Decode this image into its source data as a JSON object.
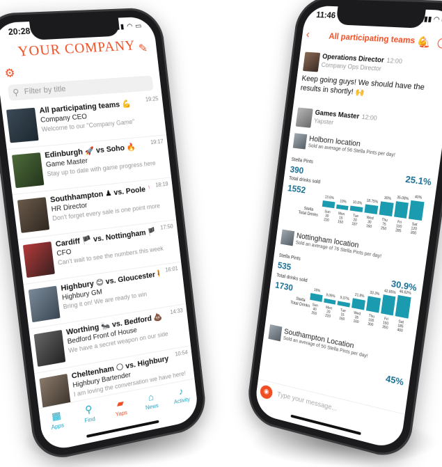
{
  "left_phone": {
    "status_time": "20:28",
    "brand": "YOUR COMPANY",
    "search_placeholder": "Filter by title",
    "rows": [
      {
        "title": "All participating teams 💪",
        "sub": "Company CEO",
        "msg": "Welcome to our \"Company Game\"",
        "time": "19:25"
      },
      {
        "title": "Edinburgh 🚀 vs Soho 🔥",
        "sub": "Game Master",
        "msg": "Stay up to date with game progress here",
        "time": "19:17"
      },
      {
        "title": "Southhampton ♟ vs. Poole 🥊",
        "sub": "HR Director",
        "msg": "Don't forget every sale is one point more",
        "time": "18:19"
      },
      {
        "title": "Cardiff 🏴 vs. Nottingham 🏴",
        "sub": "CFO",
        "msg": "Can't wait to see the numbers this week",
        "time": "17:50"
      },
      {
        "title": "Highbury 😊 vs. Gloucester 🐯",
        "sub": "Highbury GM",
        "msg": "Bring it on! We are ready to win",
        "time": "16:01"
      },
      {
        "title": "Worthing 🐜 vs. Bedford 💩",
        "sub": "Bedford Front of House",
        "msg": "We have a secret weapon on our side",
        "time": "14:33"
      },
      {
        "title": "Cheltenham 🌕 vs. Highbury 🌙",
        "sub": "Highbury Bartender",
        "msg": "I am loving the conversation we have here!",
        "time": "10:54"
      }
    ],
    "tabs": [
      {
        "label": "Apps",
        "icon": "grid-icon"
      },
      {
        "label": "Find",
        "icon": "search-icon"
      },
      {
        "label": "Yaps",
        "icon": "chat-icon"
      },
      {
        "label": "News",
        "icon": "home-icon"
      },
      {
        "label": "Activity",
        "icon": "bell-icon"
      }
    ]
  },
  "right_phone": {
    "status_time": "11:46",
    "chat_title": "All participating teams 💪",
    "messages": [
      {
        "name": "Operations Director",
        "time": "12:00",
        "role": "Company Ops Director",
        "text": "Keep going guys! We should have the results in shortly! 🙌"
      },
      {
        "name": "Games Master",
        "time": "12:00",
        "role": "Yapster",
        "text": ""
      }
    ],
    "cards": [
      {
        "title": "Holborn location",
        "desc": "Sold an average of 56 Stella Pints per day!",
        "stella_label": "Stella Pints",
        "stella_value": "390",
        "stella_pct": "25.1%",
        "total_label": "Total drinks sold",
        "total_value": "1552",
        "row_labels": [
          "Stella",
          "Total Drinks"
        ],
        "bars": [
          {
            "pct": "13.6%",
            "day": "Sun",
            "stella": "30",
            "total": "220",
            "level": 0.136
          },
          {
            "pct": "10%",
            "day": "Mon",
            "stella": "15",
            "total": "150",
            "level": 0.1
          },
          {
            "pct": "10.6%",
            "day": "Tue",
            "stella": "20",
            "total": "187",
            "level": 0.106
          },
          {
            "pct": "18.75%",
            "day": "Wed",
            "stella": "30",
            "total": "160",
            "level": 0.1875
          },
          {
            "pct": "30%",
            "day": "Thu",
            "stella": "75",
            "total": "250",
            "level": 0.3
          },
          {
            "pct": "35.08%",
            "day": "Fri",
            "stella": "100",
            "total": "285",
            "level": 0.3508
          },
          {
            "pct": "40%",
            "day": "Sat",
            "stella": "120",
            "total": "300",
            "level": 0.4
          }
        ]
      },
      {
        "title": "Nottingham location",
        "desc": "Sold an average of 76 Stella Pints per day!",
        "stella_label": "Stella Pints",
        "stella_value": "535",
        "stella_pct": "30.9%",
        "total_label": "Total drinks sold",
        "total_value": "1730",
        "row_labels": [
          "Stella",
          "Total Drinks"
        ],
        "bars": [
          {
            "pct": "16%",
            "day": "Sun",
            "stella": "40",
            "total": "250",
            "level": 0.16
          },
          {
            "pct": "9.09%",
            "day": "Mon",
            "stella": "20",
            "total": "220",
            "level": 0.0909
          },
          {
            "pct": "9.37%",
            "day": "Tue",
            "stella": "15",
            "total": "160",
            "level": 0.0937
          },
          {
            "pct": "21.8%",
            "day": "Wed",
            "stella": "35",
            "total": "160",
            "level": 0.218
          },
          {
            "pct": "33.3%",
            "day": "Thu",
            "stella": "100",
            "total": "300",
            "level": 0.333
          },
          {
            "pct": "42.85%",
            "day": "Fri",
            "stella": "150",
            "total": "350",
            "level": 0.4285
          },
          {
            "pct": "46.62%",
            "day": "Sat",
            "stella": "185",
            "total": "400",
            "level": 0.4662
          }
        ]
      },
      {
        "title": "Southampton Location",
        "desc": "Sold an average of 50 Stella Pints per day!",
        "stella_pct": "45%"
      }
    ],
    "composer_placeholder": "Type your message..."
  },
  "colors": {
    "accent": "#f04e23",
    "teal": "#1a9bb0",
    "kpi": "#1a6f93"
  }
}
